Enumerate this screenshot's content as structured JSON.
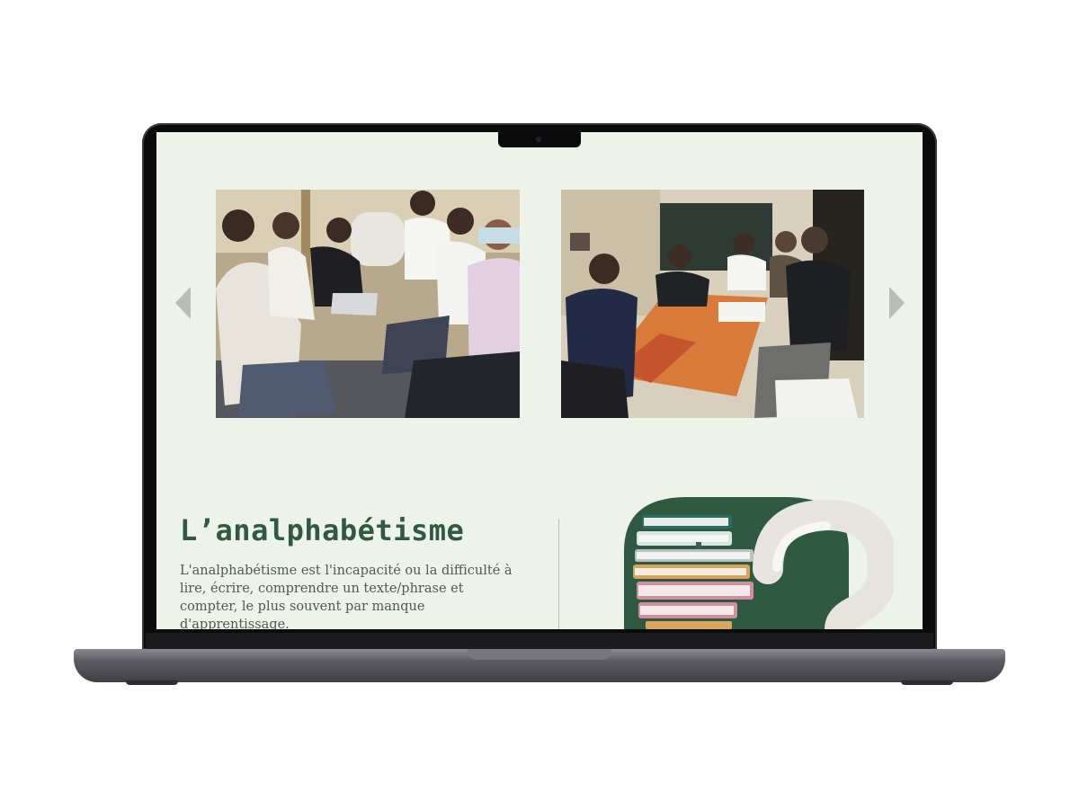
{
  "carousel": {
    "prev_icon": "chevron-left-icon",
    "next_icon": "chevron-right-icon",
    "photos": [
      {
        "subject": "group-seated-outdoors"
      },
      {
        "subject": "group-around-table-classroom"
      }
    ]
  },
  "section": {
    "title": "L’analphabétisme",
    "text": "L'analphabétisme est l'incapacité ou la difficulté à lire, écrire, comprendre un texte/phrase et compter, le plus souvent par manque d'apprentissage."
  },
  "illustration": {
    "icon": "books-question-mark-icon"
  },
  "colors": {
    "background": "#edf3e8",
    "accent_green": "#2f5a41",
    "text": "#4f5a53",
    "arrow": "#b9bdb6"
  }
}
